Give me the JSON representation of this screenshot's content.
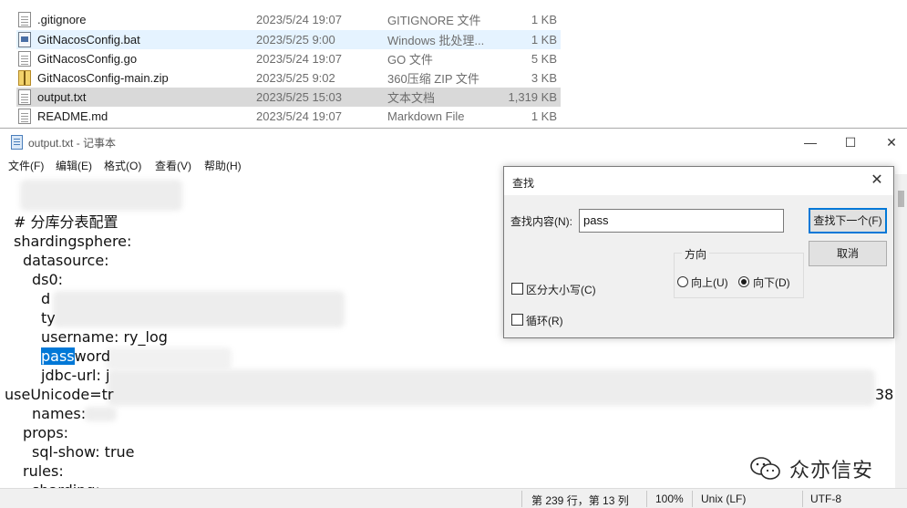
{
  "explorer": {
    "files": [
      {
        "name": ".gitignore",
        "date": "2023/5/24 19:07",
        "type": "GITIGNORE 文件",
        "size": "1 KB",
        "icon": "text-file-icon",
        "state": "normal"
      },
      {
        "name": "GitNacosConfig.bat",
        "date": "2023/5/25 9:00",
        "type": "Windows 批处理...",
        "size": "1 KB",
        "icon": "batch-file-icon",
        "state": "hover"
      },
      {
        "name": "GitNacosConfig.go",
        "date": "2023/5/24 19:07",
        "type": "GO 文件",
        "size": "5 KB",
        "icon": "text-file-icon",
        "state": "normal"
      },
      {
        "name": "GitNacosConfig-main.zip",
        "date": "2023/5/25 9:02",
        "type": "360压缩 ZIP 文件",
        "size": "3 KB",
        "icon": "zip-file-icon",
        "state": "normal"
      },
      {
        "name": "output.txt",
        "date": "2023/5/25 15:03",
        "type": "文本文档",
        "size": "1,319 KB",
        "icon": "text-file-icon",
        "state": "selected"
      },
      {
        "name": "README.md",
        "date": "2023/5/24 19:07",
        "type": "Markdown File",
        "size": "1 KB",
        "icon": "text-file-icon",
        "state": "normal"
      }
    ]
  },
  "notepad": {
    "title": "output.txt - 记事本",
    "window_controls": {
      "minimize": "—",
      "maximize": "☐",
      "close": "✕"
    },
    "menu": [
      "文件(F)",
      "编辑(E)",
      "格式(O)",
      "查看(V)",
      "帮助(H)"
    ],
    "lines": {
      "l1": "# 分库分表配置",
      "l2": "shardingsphere:",
      "l3": "datasource:",
      "l4": "ds0:",
      "l5": "d",
      "l6": "ty",
      "l7": "username: ry_log",
      "l8_highlight": "pass",
      "l8_rest": "word",
      "l9": "jdbc-url: j",
      "l10": "useUnicode=tr",
      "l10_tail": "38",
      "l11": "names:",
      "l12": "props:",
      "l13": "sql-show: true",
      "l14": "rules:",
      "l15": "sharding:"
    },
    "status": {
      "position": "第 239 行，第 13 列",
      "zoom": "100%",
      "line_ending": "Unix (LF)",
      "encoding": "UTF-8"
    }
  },
  "find_dialog": {
    "title": "查找",
    "close": "✕",
    "find_label": "查找内容(N):",
    "find_value": "pass",
    "find_next_button": "查找下一个(F)",
    "cancel_button": "取消",
    "direction_label": "方向",
    "direction_up": "向上(U)",
    "direction_down": "向下(D)",
    "direction_selected": "down",
    "match_case_label": "区分大小写(C)",
    "match_case_checked": false,
    "wrap_label": "循环(R)",
    "wrap_checked": false
  },
  "watermark": {
    "text": "众亦信安"
  },
  "colors": {
    "selection": "#0078d7",
    "hover_row": "#e5f3ff",
    "selected_row": "#d9d9d9"
  }
}
